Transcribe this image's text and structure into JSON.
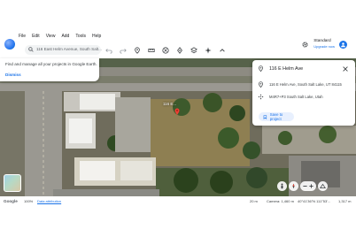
{
  "menu": {
    "items": [
      "File",
      "Edit",
      "View",
      "Add",
      "Tools",
      "Help"
    ]
  },
  "search": {
    "value": "116 East Helm Avenue, South Salt..."
  },
  "account": {
    "plan": "Standard",
    "upgrade": "Upgrade now"
  },
  "tooltip": {
    "text": "Find and manage all your projects in Google Earth.",
    "dismiss": "Dismiss"
  },
  "map": {
    "pin_label": "116 E..."
  },
  "card": {
    "title": "116 E Helm Ave",
    "address": "116 E Helm Ave, South Salt Lake, UT 84115",
    "plus_code": "M4R7+P3 South Salt Lake, Utah",
    "save_label": "Save to project"
  },
  "status": {
    "brand": "Google",
    "zoom": "100%",
    "attribution": "Data attribution",
    "scale": "20 m",
    "camera": "Camera: 1,460 m",
    "coords": "40°41'36\"N 111°53'...",
    "elevation": "1,317 m"
  },
  "icons": [
    "search-icon",
    "undo-icon",
    "redo-icon",
    "pin-icon",
    "ruler-icon",
    "layers-icon",
    "globe-icon",
    "voyager-icon",
    "projects-icon",
    "sparkle-icon",
    "chevron-up-icon",
    "gear-icon",
    "apps-icon",
    "location-icon",
    "plus-code-icon",
    "close-icon",
    "bookmark-icon",
    "street-view-icon",
    "compass-icon",
    "zoom-out-icon",
    "zoom-in-icon",
    "tilt-icon"
  ]
}
